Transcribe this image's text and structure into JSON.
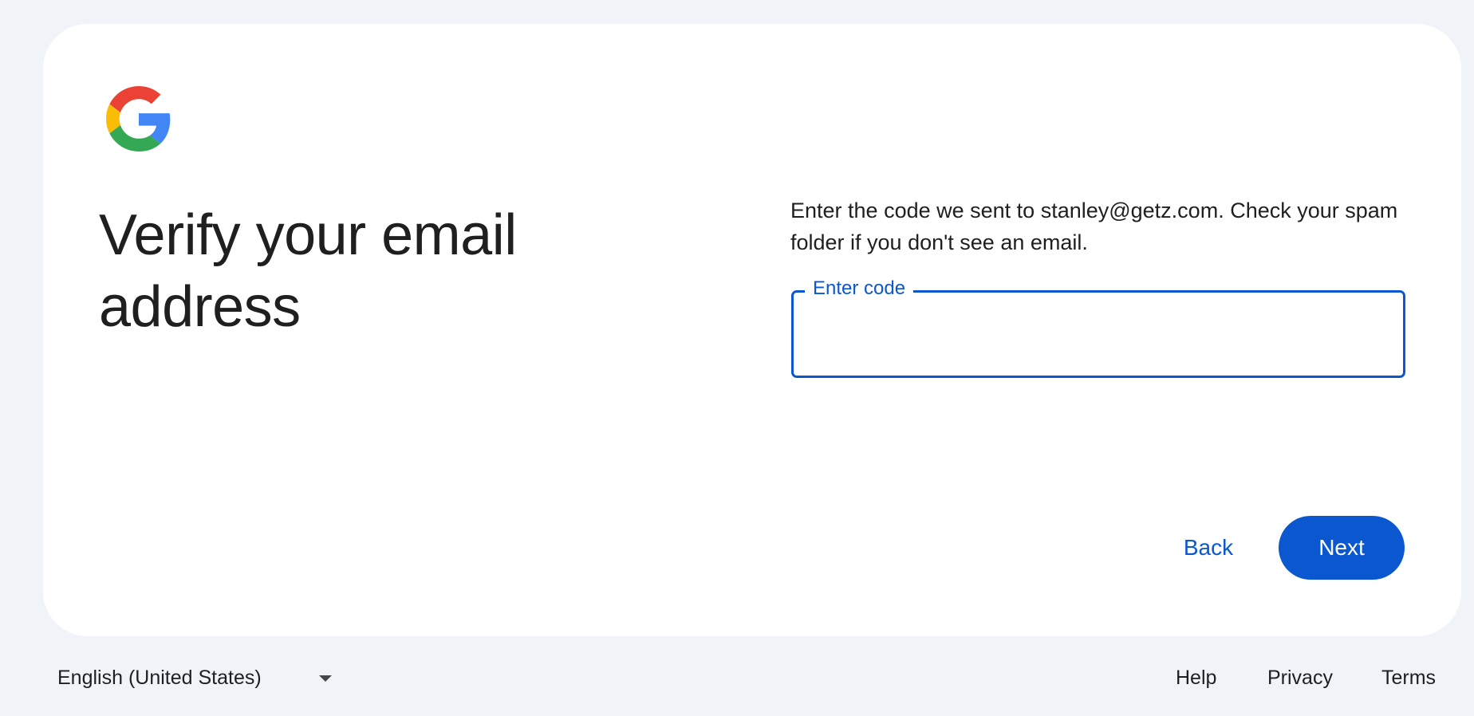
{
  "title": "Verify your email address",
  "description": "Enter the code we sent to stanley@getz.com. Check your spam folder if you don't see an email.",
  "code_field": {
    "label": "Enter code",
    "value": ""
  },
  "buttons": {
    "back": "Back",
    "next": "Next"
  },
  "footer": {
    "language": "English (United States)",
    "links": [
      "Help",
      "Privacy",
      "Terms"
    ]
  },
  "colors": {
    "accent": "#0b57d0",
    "page_bg": "#f0f4f9",
    "card_bg": "#ffffff"
  },
  "icons": {
    "logo": "google-g-icon",
    "language_caret": "caret-down-icon"
  }
}
